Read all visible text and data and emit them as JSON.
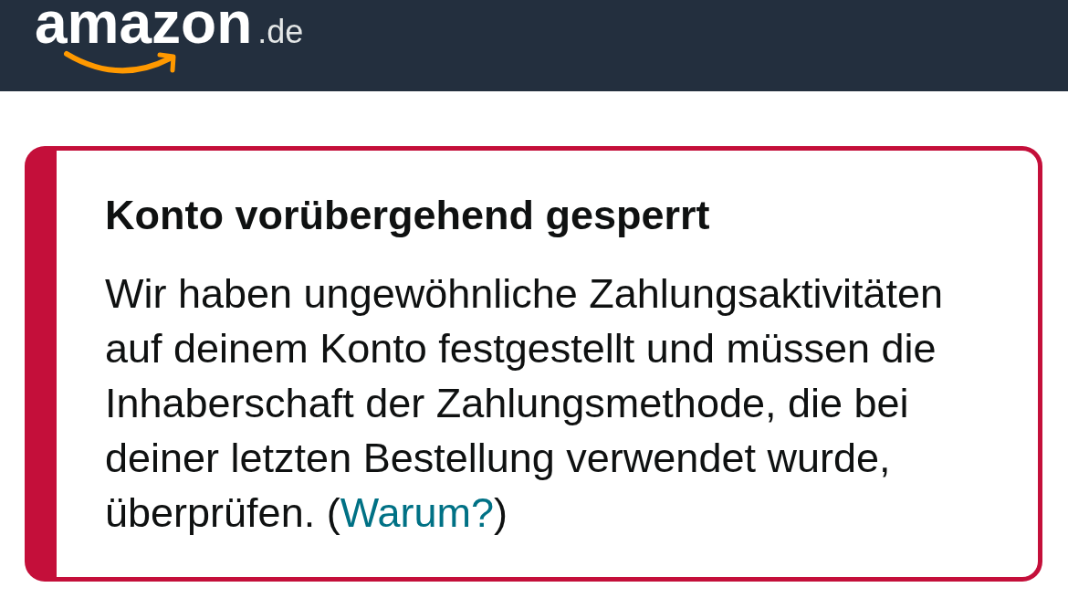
{
  "header": {
    "logo_text": "amazon",
    "logo_domain": ".de"
  },
  "alert": {
    "title": "Konto vorübergehend gesperrt",
    "message": {
      "text_before_link": "Wir haben ungewöhnliche Zahlungsaktivitäten auf deinem Konto festgestellt und müssen die Inhaberschaft der Zahlungsmethode, die bei deiner letzten Bestellung verwendet wurde, überprüfen. (",
      "link": "Warum?",
      "text_after_link": ")"
    }
  }
}
